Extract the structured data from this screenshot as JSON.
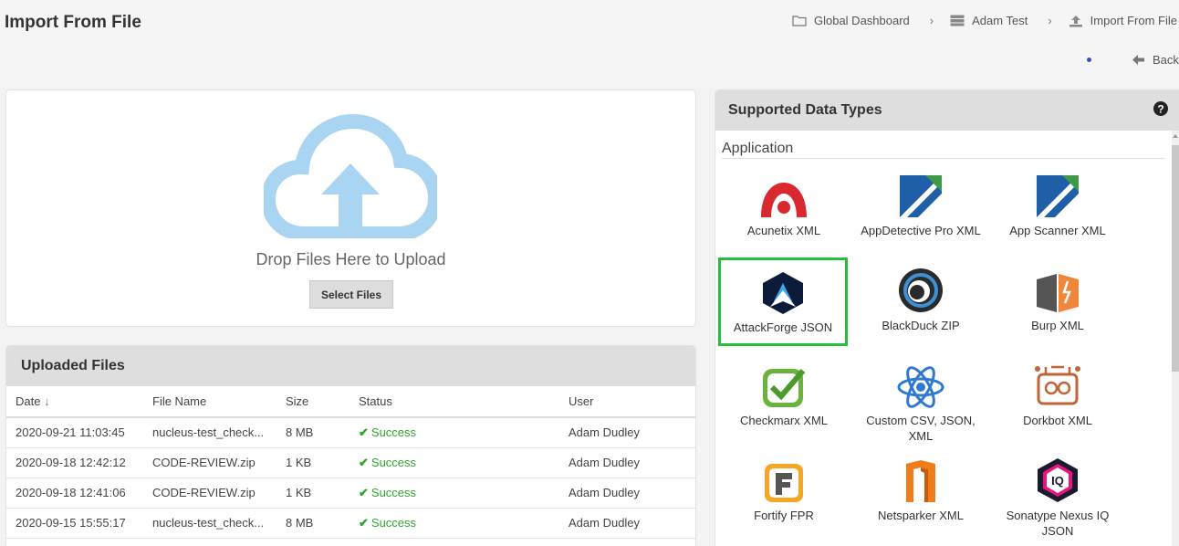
{
  "header": {
    "title": "Import From File",
    "breadcrumb": [
      {
        "label": "Global Dashboard",
        "icon": "folder-icon"
      },
      {
        "label": "Adam Test",
        "icon": "server-icon"
      },
      {
        "label": "Import From File",
        "icon": "upload-icon"
      }
    ],
    "back_label": "Back"
  },
  "upload": {
    "drop_text": "Drop Files Here to Upload",
    "select_label": "Select Files"
  },
  "uploaded": {
    "title": "Uploaded Files",
    "columns": [
      "Date",
      "File Name",
      "Size",
      "Status",
      "User"
    ],
    "rows": [
      {
        "date": "2020-09-21 11:03:45",
        "file": "nucleus-test_check...",
        "size": "8 MB",
        "status": "Success",
        "user": "Adam Dudley"
      },
      {
        "date": "2020-09-18 12:42:12",
        "file": "CODE-REVIEW.zip",
        "size": "1 KB",
        "status": "Success",
        "user": "Adam Dudley"
      },
      {
        "date": "2020-09-18 12:41:06",
        "file": "CODE-REVIEW.zip",
        "size": "1 KB",
        "status": "Success",
        "user": "Adam Dudley"
      },
      {
        "date": "2020-09-15 15:55:17",
        "file": "nucleus-test_check...",
        "size": "8 MB",
        "status": "Success",
        "user": "Adam Dudley"
      }
    ]
  },
  "types": {
    "title": "Supported Data Types",
    "section": "Application",
    "items": [
      {
        "label": "Acunetix XML"
      },
      {
        "label": "AppDetective Pro XML"
      },
      {
        "label": "App Scanner XML"
      },
      {
        "label": "AttackForge JSON"
      },
      {
        "label": "BlackDuck ZIP"
      },
      {
        "label": "Burp XML"
      },
      {
        "label": "Checkmarx XML"
      },
      {
        "label": "Custom CSV, JSON, XML"
      },
      {
        "label": "Dorkbot XML"
      },
      {
        "label": "Fortify FPR"
      },
      {
        "label": "Netsparker XML"
      },
      {
        "label": "Sonatype Nexus IQ JSON"
      }
    ]
  },
  "colors": {
    "success": "#2ea62e",
    "selected_border": "#22c03c",
    "cloud": "#a9d4f2"
  }
}
